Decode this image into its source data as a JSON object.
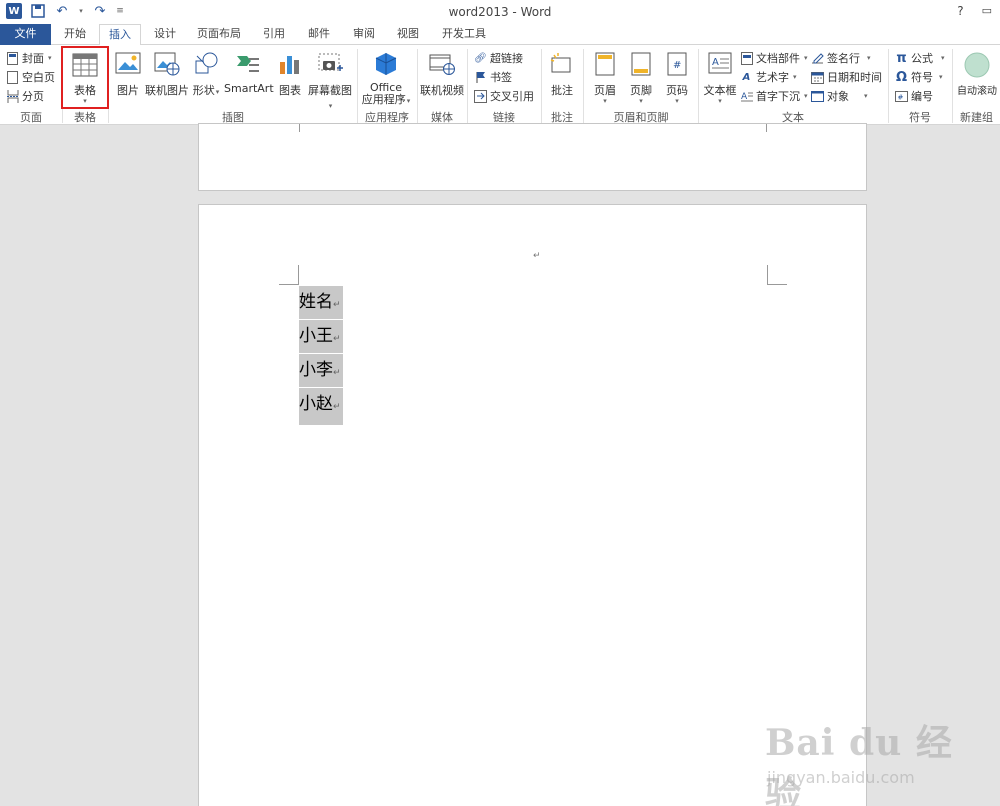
{
  "window": {
    "title": "word2013 - Word",
    "help": "?"
  },
  "tabs": [
    "文件",
    "开始",
    "插入",
    "设计",
    "页面布局",
    "引用",
    "邮件",
    "审阅",
    "视图",
    "开发工具"
  ],
  "active_tab": "插入",
  "ribbon": {
    "pages_group": {
      "label": "页面",
      "cover": "封面",
      "blank_page": "空白页",
      "page_break": "分页"
    },
    "table_group": {
      "label": "表格",
      "table": "表格"
    },
    "illustrations_group": {
      "label": "插图",
      "picture": "图片",
      "online_picture": "联机图片",
      "shapes": "形状",
      "smartart": "SmartArt",
      "chart": "图表",
      "screenshot": "屏幕截图"
    },
    "apps_group": {
      "label": "应用程序",
      "office_line1": "Office",
      "office_line2": "应用程序"
    },
    "media_group": {
      "label": "媒体",
      "online_video": "联机视频"
    },
    "links_group": {
      "label": "链接",
      "hyperlink": "超链接",
      "bookmark": "书签",
      "cross_ref": "交叉引用"
    },
    "comments_group": {
      "label": "批注",
      "comment": "批注"
    },
    "header_footer_group": {
      "label": "页眉和页脚",
      "header": "页眉",
      "footer": "页脚",
      "page_number": "页码"
    },
    "text_group": {
      "label": "文本",
      "text_box": "文本框",
      "quick_parts": "文档部件",
      "wordart": "艺术字",
      "drop_cap": "首字下沉",
      "signature_line": "签名行",
      "date_time": "日期和时间",
      "object": "对象"
    },
    "symbols_group": {
      "label": "符号",
      "equation": "公式",
      "symbol": "符号",
      "number": "编号"
    },
    "new_group": {
      "label": "新建组",
      "auto_scroll": "自动滚动"
    }
  },
  "document": {
    "lines": [
      "姓名",
      "小王",
      "小李",
      "小赵"
    ],
    "paragraph_mark": "↵"
  },
  "watermark": {
    "main": "Bai du 经验",
    "sub": "jingyan.baidu.com"
  },
  "colors": {
    "accent": "#2b579a",
    "highlight_box": "#e02020",
    "selection": "#c8c8c8"
  }
}
